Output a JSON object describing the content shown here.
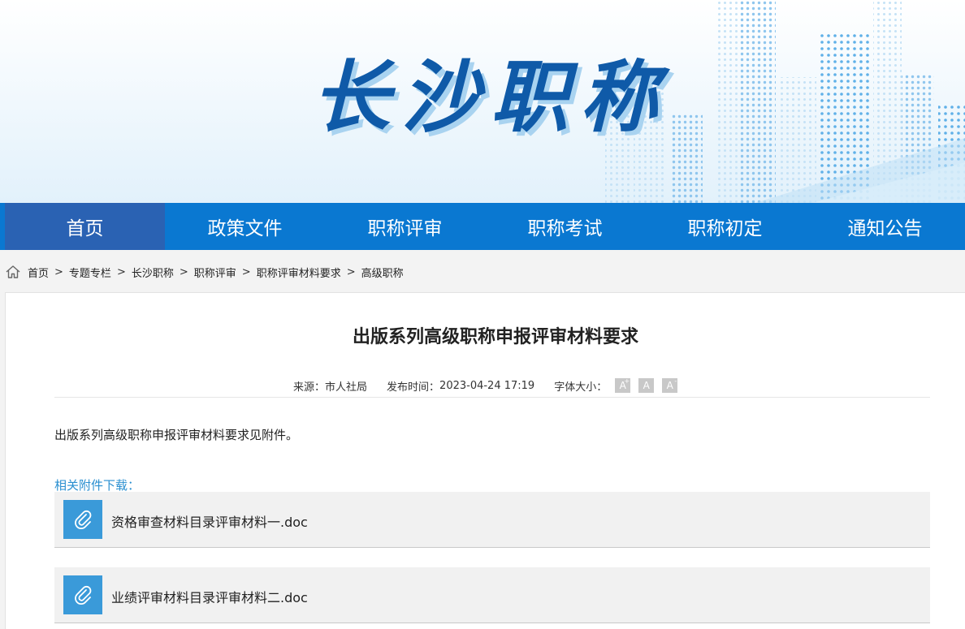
{
  "banner": {
    "title": "长沙职称"
  },
  "nav": {
    "items": [
      {
        "label": "首页",
        "active": true
      },
      {
        "label": "政策文件",
        "active": false
      },
      {
        "label": "职称评审",
        "active": false
      },
      {
        "label": "职称考试",
        "active": false
      },
      {
        "label": "职称初定",
        "active": false
      },
      {
        "label": "通知公告",
        "active": false
      }
    ]
  },
  "breadcrumb": {
    "separator": ">",
    "items": [
      "首页",
      "专题专栏",
      "长沙职称",
      "职称评审",
      "职称评审材料要求",
      "高级职称"
    ]
  },
  "article": {
    "title": "出版系列高级职称申报评审材料要求",
    "source_label": "来源：",
    "source": "市人社局",
    "publish_label": "发布时间：",
    "publish_time": "2023-04-24 17:19",
    "font_size_label": "字体大小：",
    "font_buttons": {
      "increase": "A",
      "normal": "A",
      "decrease": "A"
    },
    "body": "出版系列高级职称申报评审材料要求见附件。",
    "attachments_heading": "相关附件下载：",
    "attachments": [
      {
        "name": "资格审查材料目录评审材料一.doc"
      },
      {
        "name": "业绩评审材料目录评审材料二.doc"
      }
    ]
  },
  "colors": {
    "nav_bg": "#0a78d1",
    "nav_active": "#2a62b3",
    "title_blue": "#0f5aa8",
    "attach_icon": "#3a9ad9",
    "link_blue": "#2a8fd0"
  }
}
